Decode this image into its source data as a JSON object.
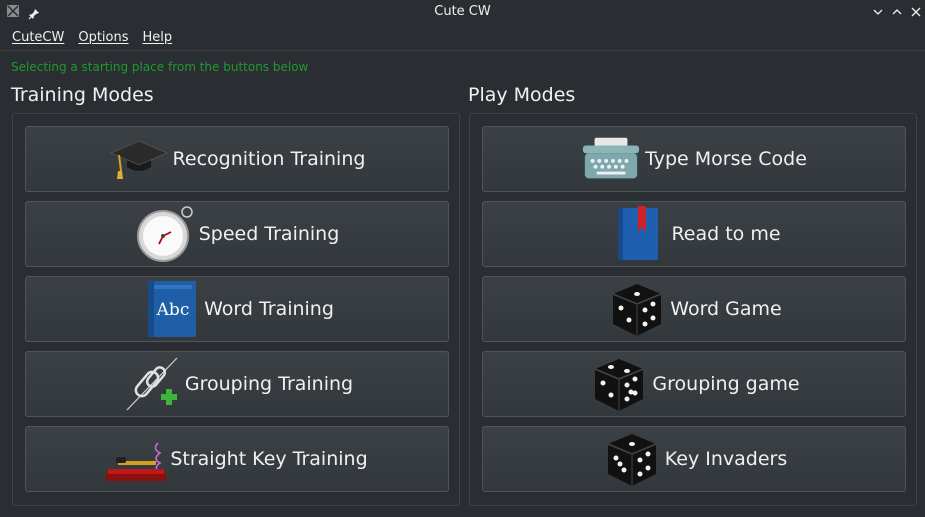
{
  "window": {
    "title": "Cute CW"
  },
  "menu": [
    "CuteCW",
    "Options",
    "Help"
  ],
  "status_text": "Selecting a starting place from the buttons below",
  "training": {
    "title": "Training Modes",
    "buttons": [
      {
        "label": "Recognition Training",
        "icon": "graduation-cap-icon"
      },
      {
        "label": "Speed Training",
        "icon": "stopwatch-icon"
      },
      {
        "label": "Word Training",
        "icon": "dictionary-book-icon"
      },
      {
        "label": "Grouping Training",
        "icon": "chain-link-add-icon"
      },
      {
        "label": "Straight Key Training",
        "icon": "telegraph-key-icon"
      }
    ]
  },
  "play": {
    "title": "Play Modes",
    "buttons": [
      {
        "label": "Type Morse Code",
        "icon": "typewriter-icon"
      },
      {
        "label": "Read to me",
        "icon": "book-bookmark-icon"
      },
      {
        "label": "Word Game",
        "icon": "dice-icon"
      },
      {
        "label": "Grouping game",
        "icon": "dice-icon"
      },
      {
        "label": "Key Invaders",
        "icon": "dice-icon"
      }
    ]
  },
  "colors": {
    "background": "#2a2e32",
    "status_text": "#1e9a2e",
    "button": "#383c40"
  }
}
